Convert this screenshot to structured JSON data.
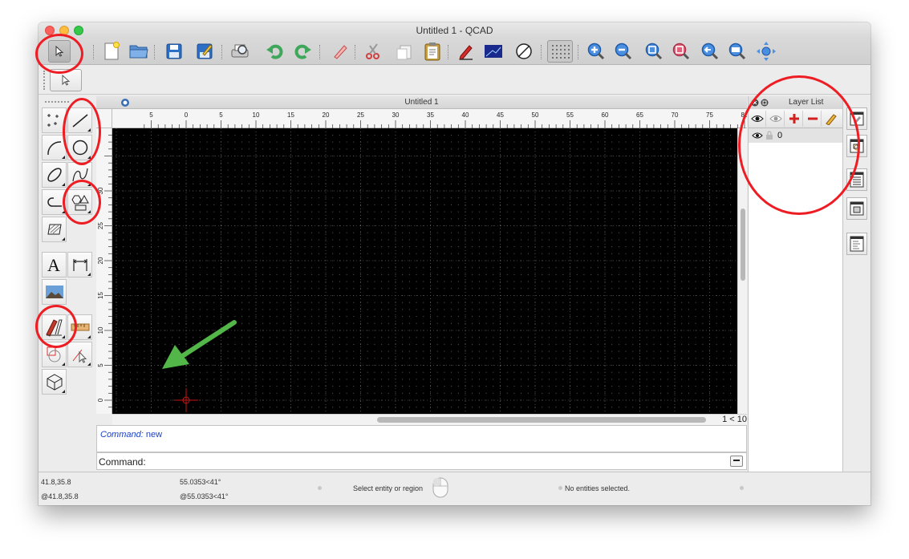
{
  "window": {
    "title": "Untitled 1 - QCAD"
  },
  "toolbar": {
    "icons": [
      "pointer-icon",
      "new-file-icon",
      "open-folder-icon",
      "save-icon",
      "save-as-icon",
      "print-preview-icon",
      "undo-icon",
      "redo-icon",
      "eraser-icon",
      "cut-icon",
      "copy-icon",
      "paste-icon",
      "pen-icon",
      "block-icon",
      "no-select-icon",
      "grid-icon",
      "zoom-in-icon",
      "zoom-out-icon",
      "zoom-auto-icon",
      "zoom-selection-icon",
      "zoom-previous-icon",
      "zoom-window-icon",
      "pan-icon"
    ]
  },
  "drawing": {
    "tab_title": "Untitled 1",
    "h_ticks": [
      "5",
      "0",
      "5",
      "10",
      "15",
      "20",
      "25",
      "30",
      "35",
      "40",
      "45",
      "50",
      "55",
      "60",
      "65",
      "70",
      "75",
      "80"
    ],
    "v_ticks": [
      "30",
      "25",
      "20",
      "15",
      "10",
      "5",
      "0",
      "5"
    ],
    "zoom_label": "1 < 10"
  },
  "command": {
    "history_keyword": "Command:",
    "history_value": "new",
    "prompt_label": "Command:"
  },
  "layer_list": {
    "title": "Layer List",
    "layers": [
      {
        "name": "0"
      }
    ]
  },
  "status": {
    "abs_coord": "41.8,35.8",
    "rel_coord": "@41.8,35.8",
    "polar": "55.0353<41°",
    "rel_polar": "@55.0353<41°",
    "mouse_hint": "Select entity or region",
    "selection": "No entities selected."
  },
  "colors": {
    "annotation_red": "#ee1d23",
    "annotation_green": "#52b748",
    "canvas_bg": "#000000",
    "origin_marker": "#c41616"
  }
}
